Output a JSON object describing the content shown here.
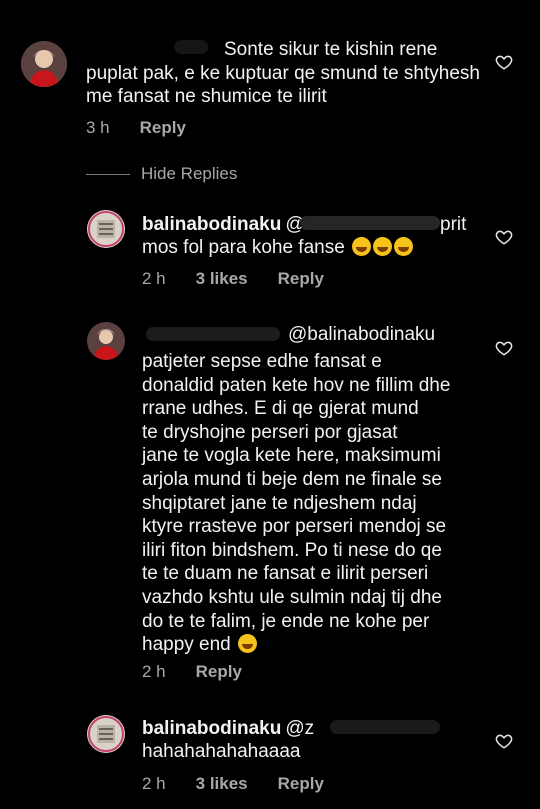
{
  "comments": [
    {
      "text": "Sonte sikur te kishin rene puplat pak, e ke kuptuar qe smund te shtyhesh me fansat ne shumice te ilirit",
      "time": "3 h",
      "reply_label": "Reply"
    }
  ],
  "replies_toggle": "Hide Replies",
  "replies": [
    {
      "username": "balinabodinaku",
      "mention": "@",
      "text_suffix": "pritmos fol para kohe fanse",
      "line1_end": "prit",
      "line2": "mos fol para kohe fanse",
      "time": "2 h",
      "likes": "3 likes",
      "reply_label": "Reply"
    },
    {
      "mention": "@balinabodinaku",
      "lines": [
        "patjeter sepse edhe fansat e",
        "donaldid paten kete hov ne fillim dhe",
        "rrane udhes. E di qe gjerat mund",
        "te  dryshojne perseri por gjasat",
        "jane te vogla kete here, maksimumi",
        "arjola mund ti beje dem ne finale se",
        "shqiptaret jane te ndjeshem ndaj",
        "ktyre rrasteve por perseri mendoj se",
        "iliri fiton bindshem. Po ti nese do qe",
        "te te duam ne fansat e ilirit perseri",
        "vazhdo kshtu ule sulmin ndaj tij dhe",
        "do te te falim, je ende ne kohe per",
        "happy end"
      ],
      "time": "2 h",
      "reply_label": "Reply"
    },
    {
      "username": "balinabodinaku",
      "mention": "@z",
      "line2": "hahahahahahaaaa",
      "time": "2 h",
      "likes": "3 likes",
      "reply_label": "Reply"
    }
  ],
  "icons": {
    "heart": "heart-outline-icon",
    "emoji_laugh": "rolling-laughing-emoji",
    "emoji_smile": "grinning-emoji"
  },
  "colors": {
    "background": "#000000",
    "text": "#f2f2f2",
    "muted": "#a8a8a8"
  }
}
